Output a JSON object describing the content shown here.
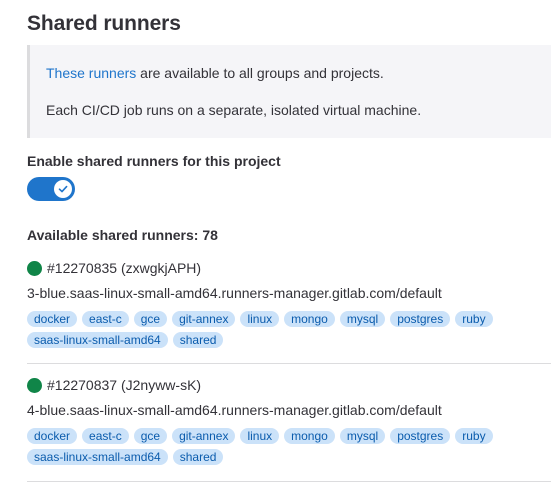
{
  "section": {
    "title": "Shared runners"
  },
  "info": {
    "link_text": "These runners",
    "line1_rest": " are available to all groups and projects.",
    "line2": "Each CI/CD job runs on a separate, isolated virtual machine."
  },
  "toggle": {
    "label": "Enable shared runners for this project",
    "enabled": true,
    "accent": "#1f75cb"
  },
  "runners_header": {
    "label": "Available shared runners: 78"
  },
  "colors": {
    "status_online": "#108548",
    "tag_bg": "#cbe2f9",
    "tag_text": "#0b5cad",
    "link": "#1f75cb"
  },
  "runners": [
    {
      "id_text": "#12270835 (zxwgkjAPH)",
      "description": "3-blue.saas-linux-small-amd64.runners-manager.gitlab.com/default",
      "status": "online",
      "tags": [
        "docker",
        "east-c",
        "gce",
        "git-annex",
        "linux",
        "mongo",
        "mysql",
        "postgres",
        "ruby",
        "saas-linux-small-amd64",
        "shared"
      ]
    },
    {
      "id_text": "#12270837 (J2nyww-sK)",
      "description": "4-blue.saas-linux-small-amd64.runners-manager.gitlab.com/default",
      "status": "online",
      "tags": [
        "docker",
        "east-c",
        "gce",
        "git-annex",
        "linux",
        "mongo",
        "mysql",
        "postgres",
        "ruby",
        "saas-linux-small-amd64",
        "shared"
      ]
    }
  ]
}
